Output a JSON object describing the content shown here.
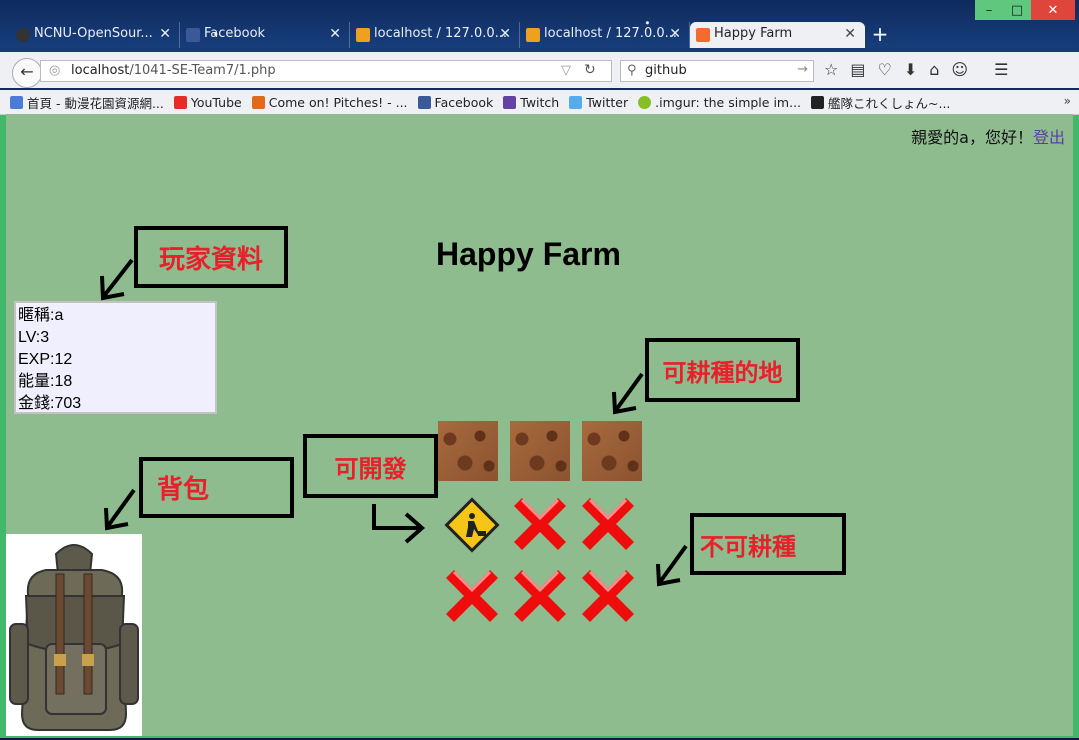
{
  "window": {
    "minimize": "–",
    "maximize": "□",
    "close": "✕"
  },
  "tabs": [
    {
      "label": "NCNU-OpenSour...",
      "icon": "github-icon",
      "color": "#333333"
    },
    {
      "label": "Facebook",
      "icon": "facebook-icon",
      "color": "#3b5998"
    },
    {
      "label": "localhost / 127.0.0...",
      "icon": "phpmyadmin-icon",
      "color": "#f0a020"
    },
    {
      "label": "localhost / 127.0.0...",
      "icon": "phpmyadmin-icon",
      "color": "#f0a020"
    },
    {
      "label": "Happy Farm",
      "icon": "xampp-icon",
      "color": "#f26c2f",
      "active": true
    }
  ],
  "newtab": "+",
  "nav": {
    "url_host": "localhost",
    "url_path": "/1041-SE-Team7/1.php",
    "search_value": "github"
  },
  "bookmarks": [
    {
      "label": "首頁 - 動漫花園資源網...",
      "color": "#4a7bd6"
    },
    {
      "label": "YouTube",
      "color": "#e52d27"
    },
    {
      "label": "Come on! Pitches! - ...",
      "color": "#e06a1c"
    },
    {
      "label": "Facebook",
      "color": "#3b5998"
    },
    {
      "label": "Twitch",
      "color": "#6441a5"
    },
    {
      "label": "Twitter",
      "color": "#55acee"
    },
    {
      "label": ".imgur: the simple im...",
      "color": "#85bf25"
    },
    {
      "label": "艦隊これくしょん~...",
      "color": "#222222"
    }
  ],
  "bookmarks_more": "»",
  "page": {
    "greeting": "親愛的a，您好！",
    "logout": "登出",
    "title": "Happy Farm",
    "player": {
      "nickname": "暱稱:a",
      "level": "LV:3",
      "exp": "EXP:12",
      "energy": "能量:18",
      "money": "金錢:703"
    }
  },
  "annotations": {
    "player_data": "玩家資料",
    "backpack": "背包",
    "developable": "可開發",
    "farmable": "可耕種的地",
    "not_farmable": "不可耕種"
  }
}
